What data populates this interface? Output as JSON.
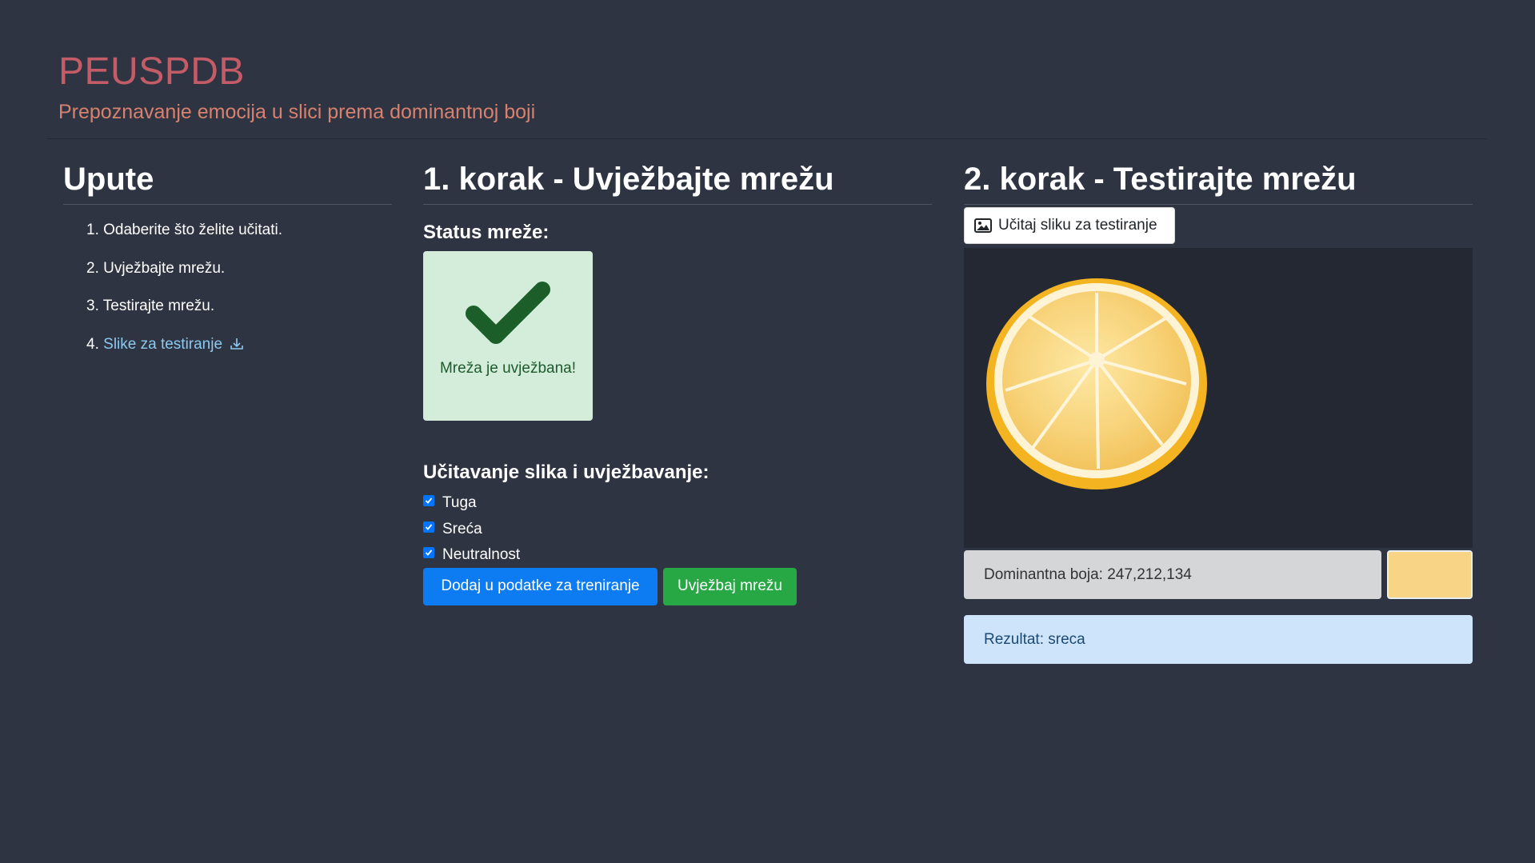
{
  "header": {
    "brand": "PEUSPDB",
    "subtitle": "Prepoznavanje emocija u slici prema dominantnoj boji"
  },
  "instructions": {
    "title": "Upute",
    "steps": [
      "1. Odaberite što želite učitati.",
      "2. Uvježbajte mrežu.",
      "3. Testirajte mrežu."
    ],
    "step4_prefix": "4.",
    "step4_link": "Slike za testiranje",
    "step4_icon": "download-icon"
  },
  "train": {
    "title": "1. korak - Uvježbajte mrežu",
    "status_label": "Status mreže:",
    "status_icon": "checkmark-icon",
    "status_text": "Mreža je uvježbana!",
    "section_label": "Učitavanje slika i uvježbavanje:",
    "options": [
      {
        "label": "Tuga",
        "checked": true
      },
      {
        "label": "Sreća",
        "checked": true
      },
      {
        "label": "Neutralnost",
        "checked": true
      }
    ],
    "add_button": "Dodaj u podatke za treniranje",
    "train_button": "Uvježbaj mrežu"
  },
  "test": {
    "title": "2. korak - Testirajte mrežu",
    "upload_button": "Učitaj sliku za testiranje",
    "upload_icon": "image-icon",
    "dominant_color_text": "Dominantna boja: 247,212,134",
    "swatch_color": "#f7d486",
    "result_text": "Rezultat: sreca"
  },
  "colors": {
    "background": "#2e3441",
    "brand": "#c45c68",
    "subtitle": "#d9816f",
    "primary": "#0d7cf2",
    "success": "#28a745",
    "status_bg": "#d4eddb",
    "result_bg": "#cde4fb"
  }
}
